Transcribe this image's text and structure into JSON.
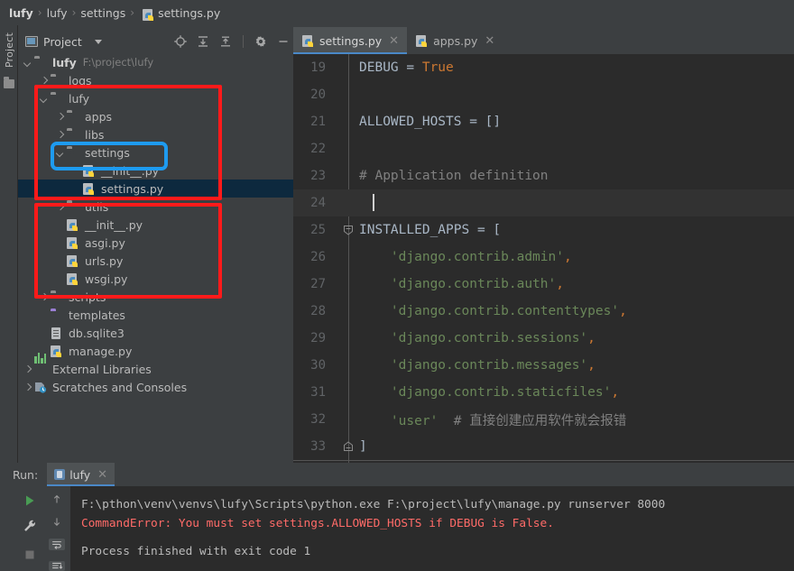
{
  "breadcrumb": {
    "items": [
      "lufy",
      "lufy",
      "settings"
    ],
    "file": "settings.py",
    "separator": "›"
  },
  "left_strip": {
    "label": "Project",
    "folder_icon": "folder-icon"
  },
  "project_panel": {
    "title": "Project",
    "dropdown_icon": "chevron-down-icon",
    "tools": [
      {
        "name": "locate-icon",
        "tooltip": "Select Opened File"
      },
      {
        "name": "expand-all-icon",
        "tooltip": "Expand All"
      },
      {
        "name": "collapse-all-icon",
        "tooltip": "Collapse All"
      },
      {
        "name": "gear-icon",
        "tooltip": "Settings"
      },
      {
        "name": "minimize-icon",
        "tooltip": "Hide"
      }
    ]
  },
  "tree": {
    "rows": [
      {
        "indent": 0,
        "arrow": "down",
        "icon": "folder",
        "label": "lufy",
        "bold": true,
        "path": "F:\\project\\lufy",
        "selected": false
      },
      {
        "indent": 1,
        "arrow": "right",
        "icon": "folder-module",
        "label": "logs",
        "bold": false,
        "path": "",
        "selected": false
      },
      {
        "indent": 1,
        "arrow": "down",
        "icon": "folder-module",
        "label": "lufy",
        "bold": false,
        "path": "",
        "selected": false
      },
      {
        "indent": 2,
        "arrow": "right",
        "icon": "folder-module",
        "label": "apps",
        "bold": false,
        "path": "",
        "selected": false
      },
      {
        "indent": 2,
        "arrow": "right",
        "icon": "folder-module",
        "label": "libs",
        "bold": false,
        "path": "",
        "selected": false
      },
      {
        "indent": 2,
        "arrow": "down",
        "icon": "folder-module",
        "label": "settings",
        "bold": false,
        "path": "",
        "selected": false
      },
      {
        "indent": 3,
        "arrow": "none",
        "icon": "python",
        "label": "__init__.py",
        "bold": false,
        "path": "",
        "selected": false
      },
      {
        "indent": 3,
        "arrow": "none",
        "icon": "python",
        "label": "settings.py",
        "bold": false,
        "path": "",
        "selected": true
      },
      {
        "indent": 2,
        "arrow": "right",
        "icon": "folder-module",
        "label": "utils",
        "bold": false,
        "path": "",
        "selected": false
      },
      {
        "indent": 2,
        "arrow": "none",
        "icon": "python",
        "label": "__init__.py",
        "bold": false,
        "path": "",
        "selected": false
      },
      {
        "indent": 2,
        "arrow": "none",
        "icon": "python",
        "label": "asgi.py",
        "bold": false,
        "path": "",
        "selected": false
      },
      {
        "indent": 2,
        "arrow": "none",
        "icon": "python",
        "label": "urls.py",
        "bold": false,
        "path": "",
        "selected": false
      },
      {
        "indent": 2,
        "arrow": "none",
        "icon": "python",
        "label": "wsgi.py",
        "bold": false,
        "path": "",
        "selected": false
      },
      {
        "indent": 1,
        "arrow": "right",
        "icon": "folder-module",
        "label": "scripts",
        "bold": false,
        "path": "",
        "selected": false
      },
      {
        "indent": 1,
        "arrow": "none",
        "icon": "folder-purple",
        "label": "templates",
        "bold": false,
        "path": "",
        "selected": false
      },
      {
        "indent": 1,
        "arrow": "none",
        "icon": "db",
        "label": "db.sqlite3",
        "bold": false,
        "path": "",
        "selected": false
      },
      {
        "indent": 1,
        "arrow": "none",
        "icon": "python",
        "label": "manage.py",
        "bold": false,
        "path": "",
        "selected": false
      },
      {
        "indent": 0,
        "arrow": "right",
        "icon": "ext-lib",
        "label": "External Libraries",
        "bold": false,
        "path": "",
        "selected": false
      },
      {
        "indent": 0,
        "arrow": "right",
        "icon": "scratches",
        "label": "Scratches and Consoles",
        "bold": false,
        "path": "",
        "selected": false
      }
    ]
  },
  "annotations": [
    {
      "name": "red-box-lufy-package",
      "color": "#ff1a1a",
      "shape": "rect"
    },
    {
      "name": "red-box-module-files",
      "color": "#ff1a1a",
      "shape": "rect"
    },
    {
      "name": "blue-box-settings-folder",
      "color": "#1e9bf0",
      "shape": "rounded-rect"
    }
  ],
  "editor": {
    "tabs": [
      {
        "label": "settings.py",
        "active": true,
        "close_icon": "close-icon"
      },
      {
        "label": "apps.py",
        "active": false,
        "close_icon": "close-icon"
      }
    ],
    "lines": [
      {
        "num": "19",
        "caret": false,
        "fold": "none",
        "tokens": [
          {
            "t": "DEBUG = ",
            "c": "var"
          },
          {
            "t": "True",
            "c": "const"
          }
        ]
      },
      {
        "num": "20",
        "caret": false,
        "fold": "none",
        "tokens": []
      },
      {
        "num": "21",
        "caret": false,
        "fold": "none",
        "tokens": [
          {
            "t": "ALLOWED_HOSTS = []",
            "c": "var"
          }
        ]
      },
      {
        "num": "22",
        "caret": false,
        "fold": "none",
        "tokens": []
      },
      {
        "num": "23",
        "caret": false,
        "fold": "none",
        "tokens": [
          {
            "t": "# Application definition",
            "c": "com"
          }
        ]
      },
      {
        "num": "24",
        "caret": true,
        "fold": "none",
        "tokens": []
      },
      {
        "num": "25",
        "caret": false,
        "fold": "open",
        "tokens": [
          {
            "t": "INSTALLED_APPS = [",
            "c": "var"
          }
        ]
      },
      {
        "num": "26",
        "caret": false,
        "fold": "none",
        "tokens": [
          {
            "t": "    'django.contrib.admin'",
            "c": "str"
          },
          {
            "t": ",",
            "c": "kw"
          }
        ]
      },
      {
        "num": "27",
        "caret": false,
        "fold": "none",
        "tokens": [
          {
            "t": "    'django.contrib.auth'",
            "c": "str"
          },
          {
            "t": ",",
            "c": "kw"
          }
        ]
      },
      {
        "num": "28",
        "caret": false,
        "fold": "none",
        "tokens": [
          {
            "t": "    'django.contrib.contenttypes'",
            "c": "str"
          },
          {
            "t": ",",
            "c": "kw"
          }
        ]
      },
      {
        "num": "29",
        "caret": false,
        "fold": "none",
        "tokens": [
          {
            "t": "    'django.contrib.sessions'",
            "c": "str"
          },
          {
            "t": ",",
            "c": "kw"
          }
        ]
      },
      {
        "num": "30",
        "caret": false,
        "fold": "none",
        "tokens": [
          {
            "t": "    'django.contrib.messages'",
            "c": "str"
          },
          {
            "t": ",",
            "c": "kw"
          }
        ]
      },
      {
        "num": "31",
        "caret": false,
        "fold": "none",
        "tokens": [
          {
            "t": "    'django.contrib.staticfiles'",
            "c": "str"
          },
          {
            "t": ",",
            "c": "kw"
          }
        ]
      },
      {
        "num": "32",
        "caret": false,
        "fold": "none",
        "tokens": [
          {
            "t": "    'user'",
            "c": "str"
          },
          {
            "t": "  # 直接创建应用软件就会报错",
            "c": "com"
          }
        ]
      },
      {
        "num": "33",
        "caret": false,
        "fold": "close",
        "tokens": [
          {
            "t": "]",
            "c": "var"
          }
        ]
      }
    ]
  },
  "run_panel": {
    "label": "Run:",
    "tab": {
      "label": "lufy",
      "close_icon": "close-icon",
      "icon": "run-config-icon"
    },
    "controls": [
      {
        "name": "rerun-icon"
      },
      {
        "name": "wrench-icon"
      },
      {
        "name": "stop-icon"
      },
      {
        "name": "arrow-up-icon"
      },
      {
        "name": "arrow-down-icon"
      },
      {
        "name": "soft-wrap-icon"
      },
      {
        "name": "scroll-to-end-icon"
      }
    ],
    "console": [
      {
        "text": "F:\\pthon\\venv\\venvs\\lufy\\Scripts\\python.exe F:\\project\\lufy\\manage.py runserver 8000",
        "style": "normal"
      },
      {
        "text": "CommandError: You must set settings.ALLOWED_HOSTS if DEBUG is False.",
        "style": "error"
      },
      {
        "text": "",
        "style": "blank"
      },
      {
        "text": "Process finished with exit code 1",
        "style": "normal"
      }
    ]
  },
  "colors": {
    "panel_bg": "#3c3f41",
    "editor_bg": "#2b2b2b",
    "selection": "#0d293e",
    "accent_tab": "#4a88c7",
    "annotation_red": "#ff1a1a",
    "annotation_blue": "#1e9bf0",
    "error_text": "#ff6b68"
  }
}
